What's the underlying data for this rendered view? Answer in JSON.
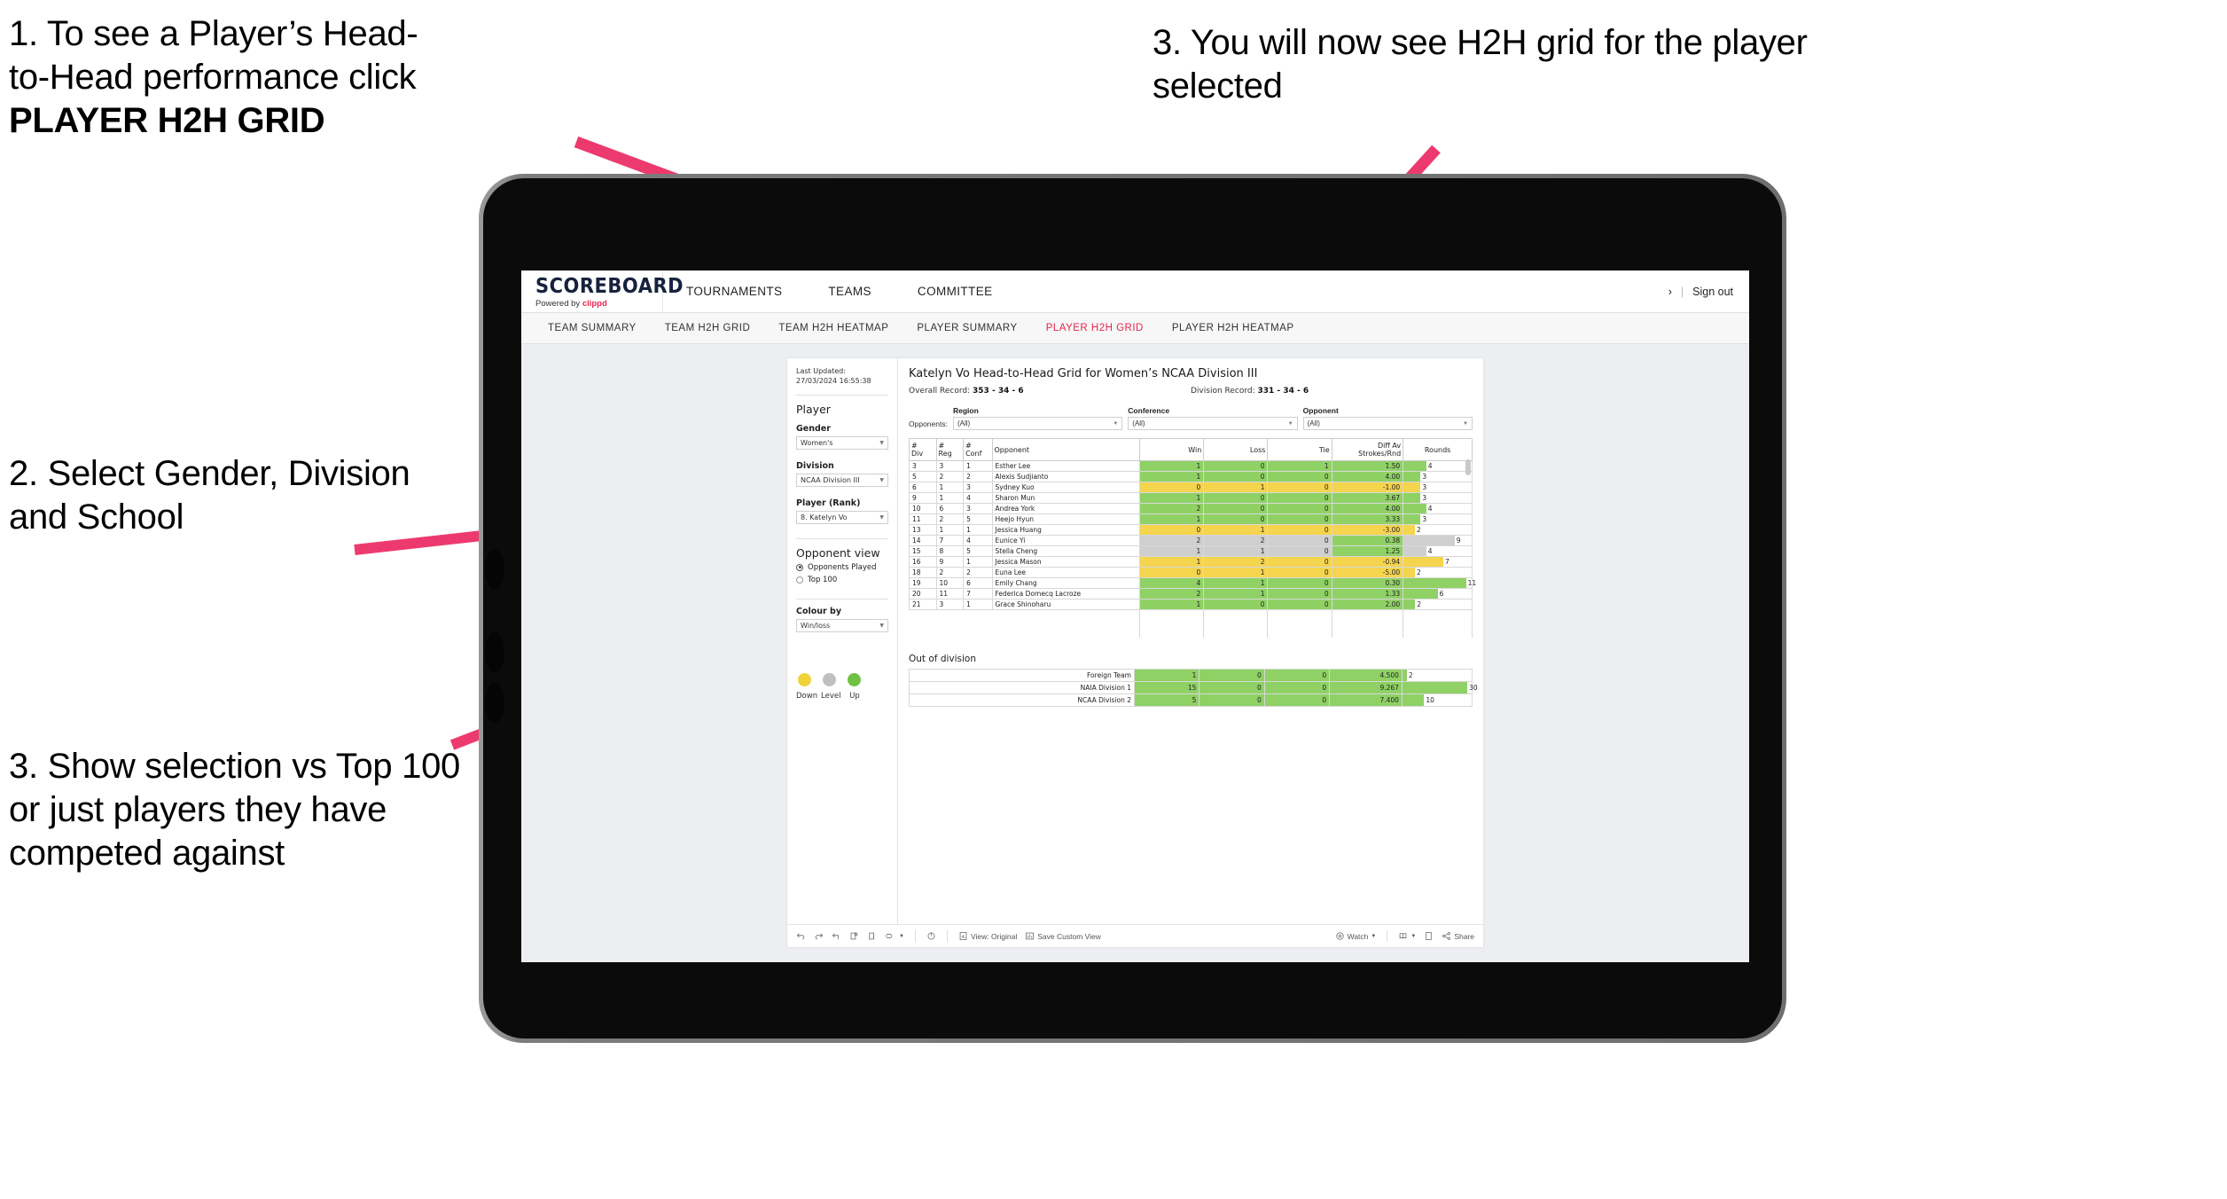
{
  "annotations": {
    "a1_line1": "1. To see a Player’s Head-",
    "a1_line2": "to-Head performance click",
    "a1_bold": "PLAYER H2H GRID",
    "a2": "2. Select Gender, Division and School",
    "a3": "3. Show selection vs Top 100 or just players they have competed against",
    "a4": "3. You will now see H2H grid for the player selected"
  },
  "app": {
    "logo_main": "SCOREBOARD",
    "logo_sub_prefix": "Powered by ",
    "logo_sub_brand": "clippd",
    "top_nav": [
      "TOURNAMENTS",
      "TEAMS",
      "COMMITTEE"
    ],
    "top_right_sep": "|",
    "sign_out": "Sign out",
    "sub_nav": [
      {
        "label": "TEAM SUMMARY",
        "active": false
      },
      {
        "label": "TEAM H2H GRID",
        "active": false
      },
      {
        "label": "TEAM H2H HEATMAP",
        "active": false
      },
      {
        "label": "PLAYER SUMMARY",
        "active": false
      },
      {
        "label": "PLAYER H2H GRID",
        "active": true
      },
      {
        "label": "PLAYER H2H HEATMAP",
        "active": false
      }
    ],
    "accent_color": "#e8254f"
  },
  "sidebar": {
    "last_updated": "Last Updated: 27/03/2024 16:55:38",
    "player_heading": "Player",
    "gender_label": "Gender",
    "gender_value": "Women's",
    "division_label": "Division",
    "division_value": "NCAA Division III",
    "player_rank_label": "Player (Rank)",
    "player_rank_value": "8. Katelyn Vo",
    "opponent_view_heading": "Opponent view",
    "opponent_options": [
      {
        "label": "Opponents Played",
        "selected": true
      },
      {
        "label": "Top 100",
        "selected": false
      }
    ],
    "colour_by_label": "Colour by",
    "colour_by_value": "Win/loss",
    "legend": [
      {
        "label": "Down",
        "color": "#f0d239"
      },
      {
        "label": "Level",
        "color": "#bfbfbf"
      },
      {
        "label": "Up",
        "color": "#70c044"
      }
    ]
  },
  "view": {
    "title": "Katelyn Vo Head-to-Head Grid for Women’s NCAA Division III",
    "overall_record_label": "Overall Record:",
    "overall_record_value": "353 - 34 - 6",
    "division_record_label": "Division Record:",
    "division_record_value": "331 - 34 - 6",
    "opponents_label": "Opponents:",
    "filters": [
      {
        "title": "Region",
        "value": "(All)"
      },
      {
        "title": "Conference",
        "value": "(All)"
      },
      {
        "title": "Opponent",
        "value": "(All)"
      }
    ]
  },
  "chart_data": {
    "type": "table",
    "title": "Katelyn Vo Head-to-Head Grid for Women’s NCAA Division III",
    "columns": [
      "# Div",
      "# Reg",
      "# Conf",
      "Opponent",
      "Win",
      "Loss",
      "Tie",
      "Diff Av Strokes/Rnd",
      "Rounds"
    ],
    "column_headers_multiline": [
      {
        "l1": "#",
        "l2": "Div"
      },
      {
        "l1": "#",
        "l2": "Reg"
      },
      {
        "l1": "#",
        "l2": "Conf"
      },
      {
        "l1": "Opponent",
        "l2": ""
      },
      {
        "l1": "Win",
        "l2": ""
      },
      {
        "l1": "Loss",
        "l2": ""
      },
      {
        "l1": "Tie",
        "l2": ""
      },
      {
        "l1": "Diff Av",
        "l2": "Strokes/Rnd"
      },
      {
        "l1": "Rounds",
        "l2": ""
      }
    ],
    "rounds_max": 12,
    "rows": [
      {
        "div": "3",
        "reg": "3",
        "conf": "1",
        "opponent": "Esther Lee",
        "win": "1",
        "loss": "0",
        "tie": "1",
        "diff": "1.50",
        "rounds": 4,
        "state": "up"
      },
      {
        "div": "5",
        "reg": "2",
        "conf": "2",
        "opponent": "Alexis Sudjianto",
        "win": "1",
        "loss": "0",
        "tie": "0",
        "diff": "4.00",
        "rounds": 3,
        "state": "up"
      },
      {
        "div": "6",
        "reg": "1",
        "conf": "3",
        "opponent": "Sydney Kuo",
        "win": "0",
        "loss": "1",
        "tie": "0",
        "diff": "-1.00",
        "rounds": 3,
        "state": "down"
      },
      {
        "div": "9",
        "reg": "1",
        "conf": "4",
        "opponent": "Sharon Mun",
        "win": "1",
        "loss": "0",
        "tie": "0",
        "diff": "3.67",
        "rounds": 3,
        "state": "up"
      },
      {
        "div": "10",
        "reg": "6",
        "conf": "3",
        "opponent": "Andrea York",
        "win": "2",
        "loss": "0",
        "tie": "0",
        "diff": "4.00",
        "rounds": 4,
        "state": "up"
      },
      {
        "div": "11",
        "reg": "2",
        "conf": "5",
        "opponent": "Heejo Hyun",
        "win": "1",
        "loss": "0",
        "tie": "0",
        "diff": "3.33",
        "rounds": 3,
        "state": "up"
      },
      {
        "div": "13",
        "reg": "1",
        "conf": "1",
        "opponent": "Jessica Huang",
        "win": "0",
        "loss": "1",
        "tie": "0",
        "diff": "-3.00",
        "rounds": 2,
        "state": "down"
      },
      {
        "div": "14",
        "reg": "7",
        "conf": "4",
        "opponent": "Eunice Yi",
        "win": "2",
        "loss": "2",
        "tie": "0",
        "diff": "0.38",
        "rounds": 9,
        "state": "level",
        "diff_state": "up"
      },
      {
        "div": "15",
        "reg": "8",
        "conf": "5",
        "opponent": "Stella Cheng",
        "win": "1",
        "loss": "1",
        "tie": "0",
        "diff": "1.25",
        "rounds": 4,
        "state": "level",
        "diff_state": "up"
      },
      {
        "div": "16",
        "reg": "9",
        "conf": "1",
        "opponent": "Jessica Mason",
        "win": "1",
        "loss": "2",
        "tie": "0",
        "diff": "-0.94",
        "rounds": 7,
        "state": "down"
      },
      {
        "div": "18",
        "reg": "2",
        "conf": "2",
        "opponent": "Euna Lee",
        "win": "0",
        "loss": "1",
        "tie": "0",
        "diff": "-5.00",
        "rounds": 2,
        "state": "down"
      },
      {
        "div": "19",
        "reg": "10",
        "conf": "6",
        "opponent": "Emily Chang",
        "win": "4",
        "loss": "1",
        "tie": "0",
        "diff": "0.30",
        "rounds": 11,
        "state": "up"
      },
      {
        "div": "20",
        "reg": "11",
        "conf": "7",
        "opponent": "Federica Domecq Lacroze",
        "win": "2",
        "loss": "1",
        "tie": "0",
        "diff": "1.33",
        "rounds": 6,
        "state": "up"
      }
    ],
    "out_of_division_title": "Out of division",
    "out_of_division_rounds_max": 32,
    "out_of_division": [
      {
        "name": "Foreign Team",
        "win": "1",
        "loss": "0",
        "tie": "0",
        "diff": "4.500",
        "rounds": 2,
        "state": "up"
      },
      {
        "name": "NAIA Division 1",
        "win": "15",
        "loss": "0",
        "tie": "0",
        "diff": "9.267",
        "rounds": 30,
        "state": "up"
      },
      {
        "name": "NCAA Division 2",
        "win": "5",
        "loss": "0",
        "tie": "0",
        "diff": "7.400",
        "rounds": 10,
        "state": "up"
      }
    ]
  },
  "toolbar": {
    "view_original": "View: Original",
    "save_custom_view": "Save Custom View",
    "watch": "Watch",
    "share": "Share"
  }
}
